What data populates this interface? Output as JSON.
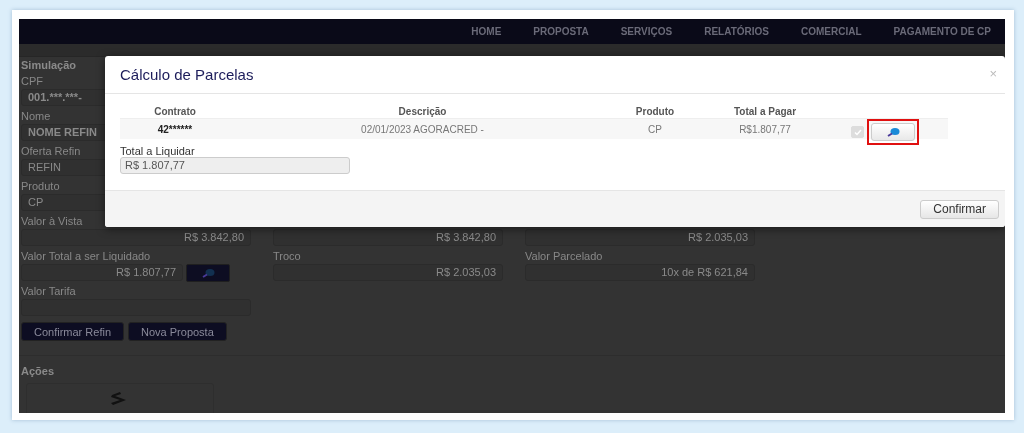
{
  "nav": {
    "items": [
      "HOME",
      "PROPOSTA",
      "SERVIÇOS",
      "RELATÓRIOS",
      "COMERCIAL",
      "PAGAMENTO DE CP"
    ]
  },
  "page": {
    "section_title": "Simulação",
    "top_fields": [
      {
        "label": "CPF",
        "value": "001.***.***-",
        "kind": "bold"
      },
      {
        "label": "Nome",
        "value": "NOME REFIN",
        "kind": "bold"
      },
      {
        "label": "Oferta Refin",
        "value": "REFIN",
        "kind": "plain"
      },
      {
        "label": "Produto",
        "value": "CP",
        "kind": "plain"
      }
    ],
    "grid_rows": [
      [
        {
          "label": "Valor à Vista",
          "value": "R$ 3.842,80",
          "kind": "plain"
        },
        {
          "value": "R$ 3.842,80",
          "kind": "plain"
        },
        {
          "value": "R$ 2.035,03",
          "kind": "plain"
        }
      ],
      [
        {
          "label": "Valor Total a ser Liquidado",
          "value": "R$ 1.807,77",
          "kind": "with-button"
        },
        {
          "label": "Troco",
          "value": "R$ 2.035,03",
          "kind": "plain"
        },
        {
          "label": "Valor Parcelado",
          "value": "10x de R$ 621,84",
          "kind": "plain"
        }
      ],
      [
        {
          "label": "Valor Tarifa",
          "kind": "plain"
        }
      ]
    ],
    "buttons": [
      "Confirmar Refin",
      "Nova Proposta"
    ],
    "actions_title": "Ações"
  },
  "modal": {
    "title": "Cálculo de Parcelas",
    "close": "×",
    "columns": [
      "Contrato",
      "Descrição",
      "Produto",
      "Total a Pagar"
    ],
    "rows": [
      {
        "contrato": "42******",
        "descricao": "02/01/2023 AGORACRED -",
        "produto": "CP",
        "total": "R$1.807,77",
        "checked": true,
        "highlighted": true
      }
    ],
    "total_label": "Total a Liquidar",
    "total_value": "R$ 1.807,77",
    "confirm": "Confirmar"
  }
}
